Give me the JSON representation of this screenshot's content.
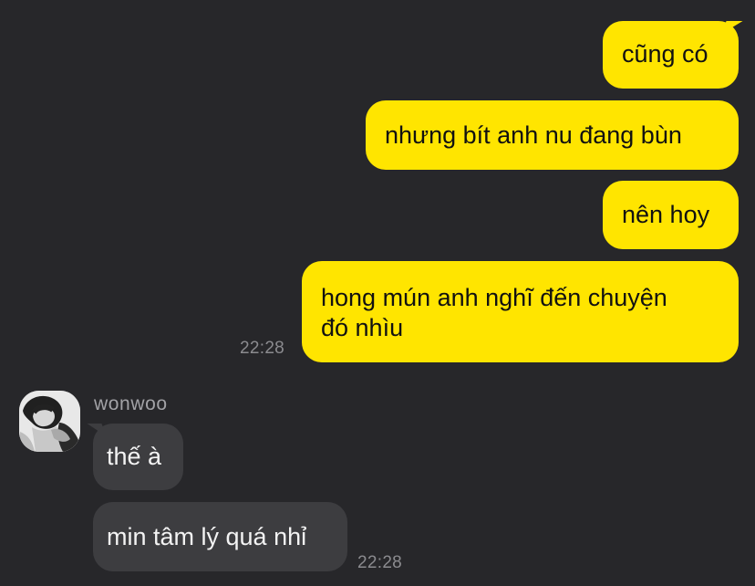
{
  "conversation": {
    "outgoing": [
      {
        "text": "cũng có"
      },
      {
        "text": "nhưng bít anh nu đang bùn"
      },
      {
        "text": "nên hoy"
      },
      {
        "text_line_1": "hong mún anh nghĩ đến chuyện",
        "text_line_2": "đó nhìu"
      }
    ],
    "outgoing_time": "22:28",
    "incoming": {
      "sender_name": "wonwoo",
      "messages": [
        {
          "text": "thế à"
        },
        {
          "text": "min tâm lý quá nhỉ"
        }
      ],
      "time": "22:28"
    }
  },
  "colors": {
    "background": "#27272a",
    "outgoing_bubble": "#ffe500",
    "incoming_bubble": "#3d3d40",
    "timestamp": "#8b8b8f"
  },
  "icons": {
    "avatar": "profile-photo-avatar"
  }
}
